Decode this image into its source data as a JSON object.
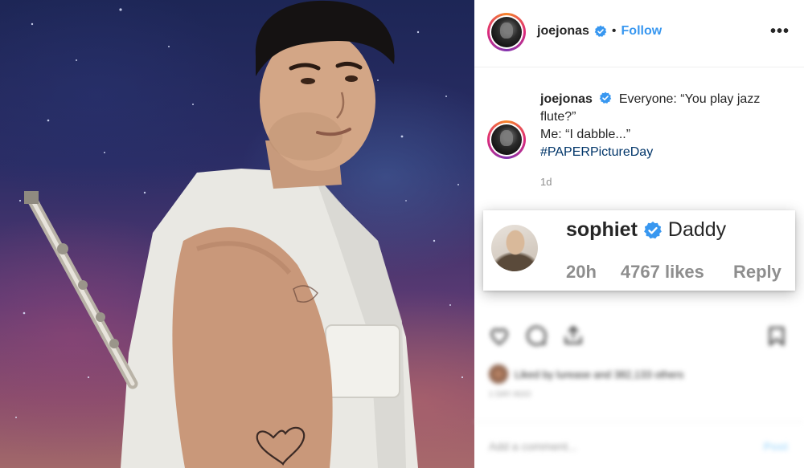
{
  "post": {
    "username": "joejonas",
    "follow_label": "Follow",
    "dot": "•",
    "more": "•••",
    "caption": {
      "username": "joejonas",
      "line1": "Everyone: “You play jazz flute?”",
      "line2": "Me: “I dabble...”",
      "hashtag": "#PAPERPictureDay"
    },
    "time": "1d"
  },
  "highlighted_comment": {
    "username": "sophiet",
    "text": "Daddy",
    "time": "20h",
    "likes": "4767 likes",
    "reply_label": "Reply"
  },
  "blurred": {
    "likes_line": "Liked by lurease and 382,133 others",
    "ago": "1 DAY AGO",
    "comment_placeholder": "Add a comment...",
    "post_label": "Post"
  },
  "colors": {
    "accent": "#3897f0",
    "verified": "#3897f0",
    "hashtag": "#003569",
    "secondary_text": "#8e8e8e"
  },
  "icons": [
    "verified-badge-icon",
    "more-options-icon",
    "heart-icon",
    "comment-icon",
    "share-icon",
    "bookmark-icon"
  ]
}
